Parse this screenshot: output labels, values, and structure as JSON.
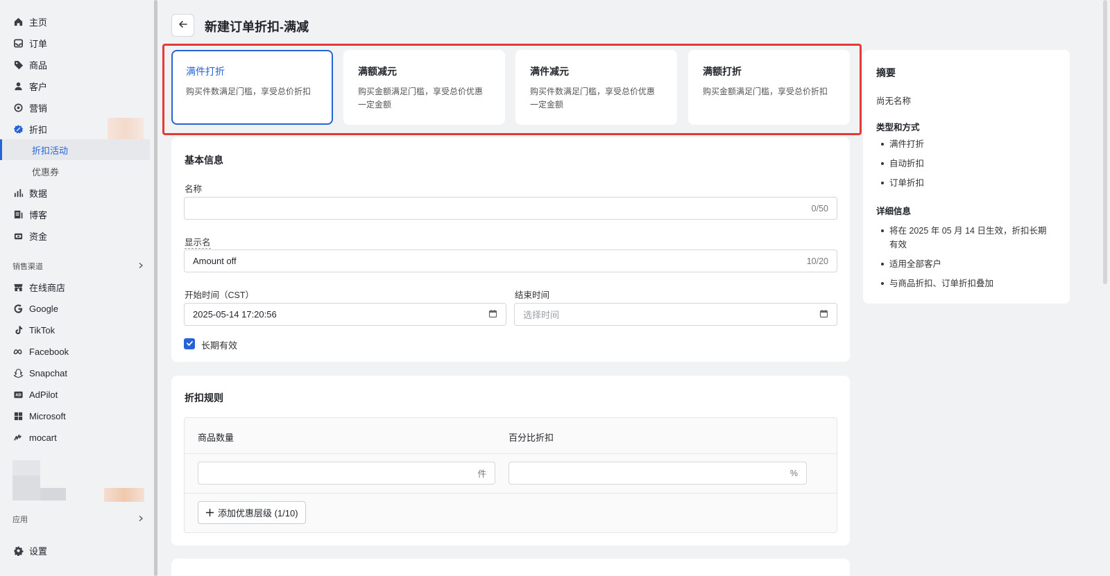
{
  "sidebar": {
    "nav": [
      {
        "label": "主页",
        "icon": "home-icon"
      },
      {
        "label": "订单",
        "icon": "inbox-icon"
      },
      {
        "label": "商品",
        "icon": "tag-icon"
      },
      {
        "label": "客户",
        "icon": "person-icon"
      },
      {
        "label": "营销",
        "icon": "target-icon"
      },
      {
        "label": "折扣",
        "icon": "discount-icon"
      }
    ],
    "sub": [
      {
        "label": "折扣活动",
        "active": true
      },
      {
        "label": "优惠券",
        "active": false
      }
    ],
    "nav2": [
      {
        "label": "数据",
        "icon": "bar-chart-icon"
      },
      {
        "label": "博客",
        "icon": "blog-icon"
      },
      {
        "label": "资金",
        "icon": "wallet-icon"
      }
    ],
    "channels_label": "销售渠道",
    "channels": [
      {
        "label": "在线商店",
        "icon": "store-icon"
      },
      {
        "label": "Google",
        "icon": "google-icon"
      },
      {
        "label": "TikTok",
        "icon": "tiktok-icon"
      },
      {
        "label": "Facebook",
        "icon": "meta-icon"
      },
      {
        "label": "Snapchat",
        "icon": "snapchat-icon"
      },
      {
        "label": "AdPilot",
        "icon": "adpilot-icon"
      },
      {
        "label": "Microsoft",
        "icon": "microsoft-icon"
      },
      {
        "label": "mocart",
        "icon": "mocart-icon"
      }
    ],
    "apps_label": "应用",
    "settings": "设置"
  },
  "header": {
    "title": "新建订单折扣-满减"
  },
  "discount_types": [
    {
      "title": "满件打折",
      "desc": "购买件数满足门槛，享受总价折扣",
      "active": true
    },
    {
      "title": "满额减元",
      "desc": "购买金额满足门槛，享受总价优惠一定金额",
      "active": false
    },
    {
      "title": "满件减元",
      "desc": "购买件数满足门槛，享受总价优惠一定金额",
      "active": false
    },
    {
      "title": "满额打折",
      "desc": "购买金额满足门槛，享受总价折扣",
      "active": false
    }
  ],
  "basic": {
    "title": "基本信息",
    "name_label": "名称",
    "name_value": "",
    "name_count": "0/50",
    "display_label": "显示名",
    "display_value": "Amount off",
    "display_count": "10/20",
    "start_label": "开始时间（CST）",
    "start_value": "2025-05-14 17:20:56",
    "end_label": "结束时间",
    "end_placeholder": "选择时间",
    "long_term_label": "长期有效",
    "long_term_checked": true
  },
  "rules": {
    "title": "折扣规则",
    "col_qty": "商品数量",
    "col_pct": "百分比折扣",
    "qty_suffix": "件",
    "pct_suffix": "%",
    "add_label": "添加优惠层级 (1/10)"
  },
  "summary": {
    "title": "摘要",
    "no_name": "尚无名称",
    "type_head": "类型和方式",
    "type_items": [
      "满件打折",
      "自动折扣",
      "订单折扣"
    ],
    "detail_head": "详细信息",
    "detail_items": [
      "将在 2025 年 05 月 14 日生效，折扣长期有效",
      "适用全部客户",
      "与商品折扣、订单折扣叠加"
    ]
  },
  "colors": {
    "accent": "#2563d6",
    "highlight": "#e53935"
  }
}
